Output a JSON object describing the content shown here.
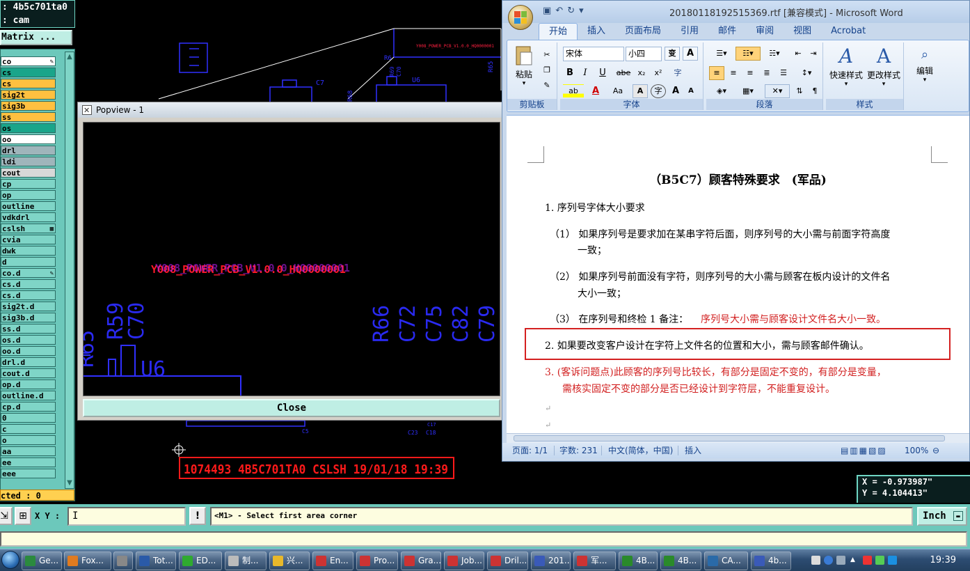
{
  "cam": {
    "title_line1": ": 4b5c701ta0",
    "title_line2": ": cam",
    "matrix_label": "Matrix ...",
    "layers": [
      {
        "label": "co",
        "bg": "#ffffff",
        "mark": "pencil"
      },
      {
        "label": "cs",
        "bg": "#1aa58a"
      },
      {
        "label": "cs",
        "bg": "#ffc040"
      },
      {
        "label": "sig2t",
        "bg": "#ffc040"
      },
      {
        "label": "sig3b",
        "bg": "#ffc040"
      },
      {
        "label": "ss",
        "bg": "#ffc040"
      },
      {
        "label": "os",
        "bg": "#1aa58a"
      },
      {
        "label": "oo",
        "bg": "#ffffff"
      },
      {
        "label": "drl",
        "bg": "#9fb5bb"
      },
      {
        "label": "ldi",
        "bg": "#9fb5bb"
      },
      {
        "label": "cout",
        "bg": "#d8d8d8"
      },
      {
        "label": "cp",
        "bg": "#7fd5c7"
      },
      {
        "label": "op",
        "bg": "#7fd5c7"
      },
      {
        "label": "outline",
        "bg": "#7fd5c7"
      },
      {
        "label": "vdkdrl",
        "bg": "#7fd5c7"
      },
      {
        "label": "cslsh",
        "bg": "#7fd5c7",
        "mark": "grid"
      },
      {
        "label": "cvia",
        "bg": "#7fd5c7"
      },
      {
        "label": "dwk",
        "bg": "#7fd5c7"
      },
      {
        "label": "d",
        "bg": "#7fd5c7"
      },
      {
        "label": "co.d",
        "bg": "#7fd5c7",
        "mark": "pencil"
      },
      {
        "label": "cs.d",
        "bg": "#7fd5c7"
      },
      {
        "label": "cs.d",
        "bg": "#7fd5c7"
      },
      {
        "label": "sig2t.d",
        "bg": "#7fd5c7"
      },
      {
        "label": "sig3b.d",
        "bg": "#7fd5c7"
      },
      {
        "label": "ss.d",
        "bg": "#7fd5c7"
      },
      {
        "label": "os.d",
        "bg": "#7fd5c7"
      },
      {
        "label": "oo.d",
        "bg": "#7fd5c7"
      },
      {
        "label": "drl.d",
        "bg": "#7fd5c7"
      },
      {
        "label": "cout.d",
        "bg": "#7fd5c7"
      },
      {
        "label": "op.d",
        "bg": "#7fd5c7"
      },
      {
        "label": "outline.d",
        "bg": "#7fd5c7"
      },
      {
        "label": "cp.d",
        "bg": "#7fd5c7"
      },
      {
        "label": "0",
        "bg": "#7fd5c7"
      },
      {
        "label": "c",
        "bg": "#7fd5c7"
      },
      {
        "label": "o",
        "bg": "#7fd5c7"
      },
      {
        "label": "aa",
        "bg": "#7fd5c7"
      },
      {
        "label": "ee",
        "bg": "#7fd5c7"
      },
      {
        "label": "eee",
        "bg": "#7fd5c7"
      }
    ],
    "selected_label": "cted : 0",
    "canvas_labels": {
      "c7": "C7",
      "r6": "R6",
      "r65": "R65",
      "u6": "U6",
      "r68": "R68",
      "r69": "R69",
      "c70": "C70",
      "c5": "C5",
      "c23": "C23",
      "c18": "C18",
      "c17": "C17",
      "small_text": "Y008_POWER_PCB_V1.0.0_HQ0000001",
      "serial": "1074493  4B5C701TA0 CSLSH 19/01/18 19:39"
    },
    "popview": {
      "title": "Popview - 1",
      "close_label": "Close",
      "text_red": "Y008_POWER_PCB_V1.0.0_HQ0000001",
      "labels": {
        "r59": "R59",
        "c70": "C70",
        "u6": "U6",
        "r66": "R66",
        "c72": "C72",
        "c75": "C75",
        "c82": "C82",
        "c79": "C79",
        "r_partial": "R65"
      }
    },
    "coords": {
      "x": "X = -0.973987\"",
      "y": "Y =  4.104413\""
    },
    "xy_label": "X Y :",
    "xy_value": "",
    "command_message": "<M1> - Select first area corner",
    "unit_label": "Inch"
  },
  "word": {
    "title": "20180118192515369.rtf [兼容模式] - Microsoft Word",
    "tabs": [
      "开始",
      "插入",
      "页面布局",
      "引用",
      "邮件",
      "审阅",
      "视图",
      "Acrobat"
    ],
    "active_tab": "开始",
    "ribbon": {
      "paste_label": "粘贴",
      "clipboard_label": "剪贴板",
      "font_name": "宋体",
      "font_size": "小四",
      "font_group_label": "字体",
      "paragraph_label": "段落",
      "styles_label": "样式",
      "quick_styles": "快速样式",
      "change_styles": "更改样式",
      "edit_label": "编辑",
      "wen": "变",
      "a_box": "A",
      "bold": "B",
      "italic": "I",
      "underline": "U",
      "strike": "abe",
      "sub": "x₂",
      "sup": "x²",
      "aa": "Aa",
      "grow": "A",
      "shrink": "A",
      "highlight": "ab",
      "fontcolor": "A",
      "char_border": "A",
      "phonetic": "字"
    },
    "document": {
      "title": "（B5C7）顾客特殊要求　(军品)",
      "lines": [
        {
          "text": "1.  序列号字体大小要求",
          "color": "normal"
        },
        {
          "text": "（1）  如果序列号是要求加在某串字符后面，则序列号的大小需与前面字符高度",
          "color": "normal"
        },
        {
          "text": "一致；",
          "color": "normal"
        },
        {
          "text": "（2）  如果序列号前面没有字符，则序列号的大小需与顾客在板内设计的文件名",
          "color": "normal"
        },
        {
          "text": "大小一致；",
          "color": "normal"
        },
        {
          "text": "（3）  在序列号和终检 1 备注：",
          "color": "normal"
        },
        {
          "text": "序列号大小需与顾客设计文件名大小一致。",
          "color": "red"
        },
        {
          "text": "2.  如果要改变客户设计在字符上文件名的位置和大小，需与顾客邮件确认。",
          "color": "normal"
        },
        {
          "text": "3.  (客诉问题点)此顾客的序列号比较长，有部分是固定不变的，有部分是变量，",
          "color": "red"
        },
        {
          "text": "需核实固定不变的部分是否已经设计到字符层，不能重复设计。",
          "color": "red"
        }
      ]
    },
    "status": {
      "page": "页面: 1/1",
      "words": "字数: 231",
      "language": "中文(简体，中国)",
      "insert_mode": "插入",
      "zoom": "100%"
    },
    "accent": "#15428b"
  },
  "taskbar": {
    "items": [
      "Ge...",
      "Fox...",
      "",
      "Tot...",
      "ED...",
      "制...",
      "兴...",
      "En...",
      "Pro...",
      "Gra...",
      "Job...",
      "Dril...",
      "201...",
      "军...",
      "4B...",
      "4B...",
      "CA...",
      "4b..."
    ],
    "clock": "19:39"
  }
}
